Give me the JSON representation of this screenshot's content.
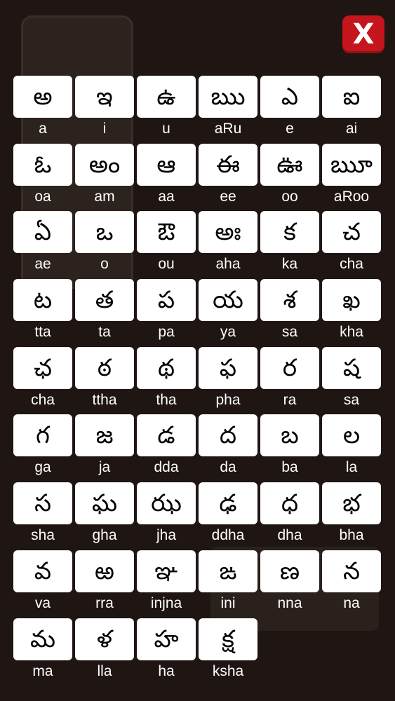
{
  "close_button": {
    "label": "X"
  },
  "letters": [
    {
      "glyph": "అ",
      "translit": "a"
    },
    {
      "glyph": "ఇ",
      "translit": "i"
    },
    {
      "glyph": "ఉ",
      "translit": "u"
    },
    {
      "glyph": "ఋ",
      "translit": "aRu"
    },
    {
      "glyph": "ఎ",
      "translit": "e"
    },
    {
      "glyph": "ఐ",
      "translit": "ai"
    },
    {
      "glyph": "ఓ",
      "translit": "oa"
    },
    {
      "glyph": "అం",
      "translit": "am"
    },
    {
      "glyph": "ఆ",
      "translit": "aa"
    },
    {
      "glyph": "ఈ",
      "translit": "ee"
    },
    {
      "glyph": "ఊ",
      "translit": "oo"
    },
    {
      "glyph": "ౠ",
      "translit": "aRoo"
    },
    {
      "glyph": "ఏ",
      "translit": "ae"
    },
    {
      "glyph": "ఒ",
      "translit": "o"
    },
    {
      "glyph": "ఔ",
      "translit": "ou"
    },
    {
      "glyph": "అః",
      "translit": "aha"
    },
    {
      "glyph": "క",
      "translit": "ka"
    },
    {
      "glyph": "చ",
      "translit": "cha"
    },
    {
      "glyph": "ట",
      "translit": "tta"
    },
    {
      "glyph": "త",
      "translit": "ta"
    },
    {
      "glyph": "ప",
      "translit": "pa"
    },
    {
      "glyph": "య",
      "translit": "ya"
    },
    {
      "glyph": "శ",
      "translit": "sa"
    },
    {
      "glyph": "ఖ",
      "translit": "kha"
    },
    {
      "glyph": "ఛ",
      "translit": "cha"
    },
    {
      "glyph": "ఠ",
      "translit": "ttha"
    },
    {
      "glyph": "థ",
      "translit": "tha"
    },
    {
      "glyph": "ఫ",
      "translit": "pha"
    },
    {
      "glyph": "ర",
      "translit": "ra"
    },
    {
      "glyph": "ష",
      "translit": "sa"
    },
    {
      "glyph": "గ",
      "translit": "ga"
    },
    {
      "glyph": "జ",
      "translit": "ja"
    },
    {
      "glyph": "డ",
      "translit": "dda"
    },
    {
      "glyph": "ద",
      "translit": "da"
    },
    {
      "glyph": "బ",
      "translit": "ba"
    },
    {
      "glyph": "ల",
      "translit": "la"
    },
    {
      "glyph": "స",
      "translit": "sha"
    },
    {
      "glyph": "ఘ",
      "translit": "gha"
    },
    {
      "glyph": "ఝ",
      "translit": "jha"
    },
    {
      "glyph": "ఢ",
      "translit": "ddha"
    },
    {
      "glyph": "ధ",
      "translit": "dha"
    },
    {
      "glyph": "భ",
      "translit": "bha"
    },
    {
      "glyph": "వ",
      "translit": "va"
    },
    {
      "glyph": "ఱ",
      "translit": "rra"
    },
    {
      "glyph": "ఞ",
      "translit": "injna"
    },
    {
      "glyph": "ఙ",
      "translit": "ini"
    },
    {
      "glyph": "ణ",
      "translit": "nna"
    },
    {
      "glyph": "న",
      "translit": "na"
    },
    {
      "glyph": "మ",
      "translit": "ma"
    },
    {
      "glyph": "ళ",
      "translit": "lla"
    },
    {
      "glyph": "హ",
      "translit": "ha"
    },
    {
      "glyph": "క్ష",
      "translit": "ksha"
    }
  ]
}
